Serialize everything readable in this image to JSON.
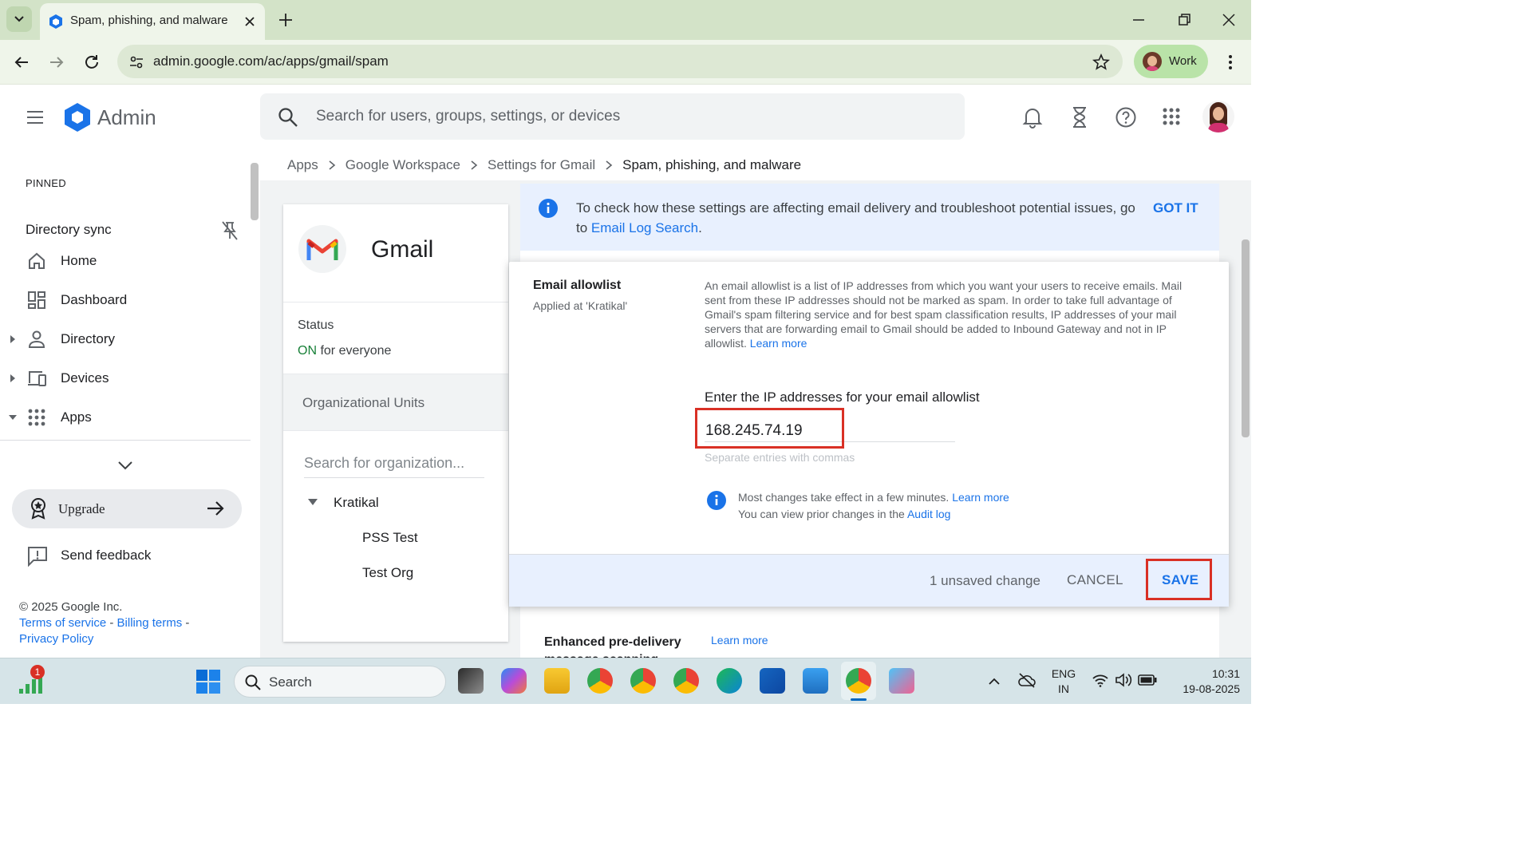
{
  "browser": {
    "tab_title": "Spam, phishing, and malware",
    "url": "admin.google.com/ac/apps/gmail/spam",
    "profile_label": "Work"
  },
  "admin": {
    "brand": "Admin",
    "search_placeholder": "Search for users, groups, settings, or devices"
  },
  "sidebar": {
    "pinned_heading": "PINNED",
    "pinned_item": "Directory sync",
    "items": [
      {
        "label": "Home",
        "icon": "home-icon"
      },
      {
        "label": "Dashboard",
        "icon": "dashboard-icon"
      },
      {
        "label": "Directory",
        "icon": "person-icon"
      },
      {
        "label": "Devices",
        "icon": "devices-icon"
      },
      {
        "label": "Apps",
        "icon": "apps-grid-icon"
      }
    ],
    "upgrade_label": "Upgrade",
    "feedback_label": "Send feedback",
    "copyright": "© 2025 Google Inc.",
    "terms": "Terms of service",
    "billing": "Billing terms",
    "privacy": "Privacy Policy",
    "dash": "-",
    "dash2": "-"
  },
  "breadcrumb": [
    "Apps",
    "Google Workspace",
    "Settings for Gmail",
    "Spam, phishing, and malware"
  ],
  "gmail_card": {
    "title": "Gmail",
    "status_heading": "Status",
    "status_on": "ON",
    "status_rest": " for everyone",
    "ou_heading": "Organizational Units",
    "ou_search_placeholder": "Search for organization...",
    "ou_root": "Kratikal",
    "ou_children": [
      "PSS Test",
      "Test Org"
    ]
  },
  "info_banner": {
    "text": "To check how these settings are affecting email delivery and troubleshoot potential issues, go",
    "text2_prefix": "to ",
    "link": "Email Log Search",
    "text2_suffix": ".",
    "dismiss": "GOT IT"
  },
  "allowlist": {
    "title": "Email allowlist",
    "applied": "Applied at 'Kratikal'",
    "description": "An email allowlist is a list of IP addresses from which you want your users to receive emails. Mail sent from these IP addresses should not be marked as spam. In order to take full advantage of Gmail's spam filtering service and for best spam classification results, IP addresses of your mail servers that are forwarding email to Gmail should be added to Inbound Gateway and not in IP allowlist.",
    "learn_more": "Learn more",
    "field_label": "Enter the IP addresses for your email allowlist",
    "field_value": "168.245.74.19",
    "field_hint": "Separate entries with commas",
    "note1": "Most changes take effect in a few minutes.",
    "note1_link": "Learn more",
    "note2": "You can view prior changes in the",
    "note2_link": "Audit log",
    "unsaved": "1 unsaved change",
    "cancel": "CANCEL",
    "save": "SAVE"
  },
  "next_section": {
    "title": "Enhanced pre-delivery",
    "title2": "message scanning",
    "link": "Learn more"
  },
  "taskbar": {
    "search_placeholder": "Search",
    "notification_badge": "1",
    "lang1": "ENG",
    "lang2": "IN",
    "time": "10:31",
    "date": "19-08-2025"
  },
  "colors": {
    "accent": "#1a73e8",
    "on_green": "#188038",
    "highlight_red": "#d93025"
  }
}
